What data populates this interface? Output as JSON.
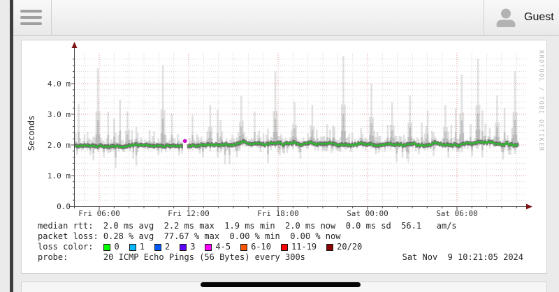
{
  "header": {
    "user_label": "Guest"
  },
  "chart_data": {
    "type": "area",
    "subtype": "smokeping-latency-smoke",
    "ylabel": "Seconds",
    "x_tick_labels": [
      "Fri 06:00",
      "Fri 12:00",
      "Fri 18:00",
      "Sat 00:00",
      "Sat 06:00"
    ],
    "y_ticks": [
      {
        "label": "4.0 m",
        "ms": 4.0
      },
      {
        "label": "3.0 m",
        "ms": 3.0
      },
      {
        "label": "2.0 m",
        "ms": 2.0
      },
      {
        "label": "1.0 m",
        "ms": 1.0
      },
      {
        "label": "0.0",
        "ms": 0.0
      }
    ],
    "ylim_ms": [
      0.0,
      5.0
    ],
    "grid": {
      "major_color": "#e79b9b",
      "minor_color": "#d8d8d8"
    },
    "axis_color": "#4a4a4a",
    "arrow_color": "#7c1414",
    "median_ms": {
      "avg": 2.0,
      "max": 2.2,
      "min": 1.9,
      "now": 2.0,
      "sd": 0.0
    },
    "packet_loss_pct": {
      "avg": 0.28,
      "max": 77.67,
      "min": 0.0,
      "now": 0.0
    },
    "baseline_ms": 2.0,
    "points": 300,
    "seed": 20241109,
    "spikes": [
      {
        "pos": 0.049,
        "ms": 4.5
      },
      {
        "pos": 0.117,
        "ms": 3.1
      },
      {
        "pos": 0.197,
        "ms": 4.6
      },
      {
        "pos": 0.304,
        "ms": 3.3
      },
      {
        "pos": 0.376,
        "ms": 3.6
      },
      {
        "pos": 0.452,
        "ms": 4.4
      },
      {
        "pos": 0.494,
        "ms": 3.4
      },
      {
        "pos": 0.534,
        "ms": 3.3
      },
      {
        "pos": 0.606,
        "ms": 4.9
      },
      {
        "pos": 0.668,
        "ms": 4.0
      },
      {
        "pos": 0.715,
        "ms": 3.4
      },
      {
        "pos": 0.757,
        "ms": 3.6
      },
      {
        "pos": 0.836,
        "ms": 3.3
      },
      {
        "pos": 0.872,
        "ms": 4.3
      },
      {
        "pos": 0.91,
        "ms": 4.8
      },
      {
        "pos": 0.954,
        "ms": 3.6
      },
      {
        "pos": 0.992,
        "ms": 4.4
      }
    ],
    "loss_event": {
      "pos": 0.247,
      "ms": 2.13,
      "color": "#cf00cf"
    },
    "median_color": "#2db82d",
    "smoke_color": "#6e6e6e",
    "watermark": "RRDTOOL / TOBI OETIKER"
  },
  "legend": {
    "line1": "median rtt:  2.0 ms avg  2.2 ms max  1.9 ms min  2.0 ms now  0.0 ms sd  56.1   am/s",
    "line2": "packet loss: 0.28 % avg  77.67 % max  0.00 % min  0.00 % now",
    "loss_label": "loss color:",
    "loss_items": [
      {
        "label": "0",
        "color": "#00ff00"
      },
      {
        "label": "1",
        "color": "#00b8ff"
      },
      {
        "label": "2",
        "color": "#0059ff"
      },
      {
        "label": "3",
        "color": "#5e00ff"
      },
      {
        "label": "4-5",
        "color": "#ff00ff"
      },
      {
        "label": "6-10",
        "color": "#ff5500"
      },
      {
        "label": "11-19",
        "color": "#ff0000"
      },
      {
        "label": "20/20",
        "color": "#8b0000"
      }
    ],
    "line4": "probe:       20 ICMP Echo Pings (56 Bytes) every 300s",
    "timestamp": "Sat Nov  9 10:21:05 2024"
  }
}
